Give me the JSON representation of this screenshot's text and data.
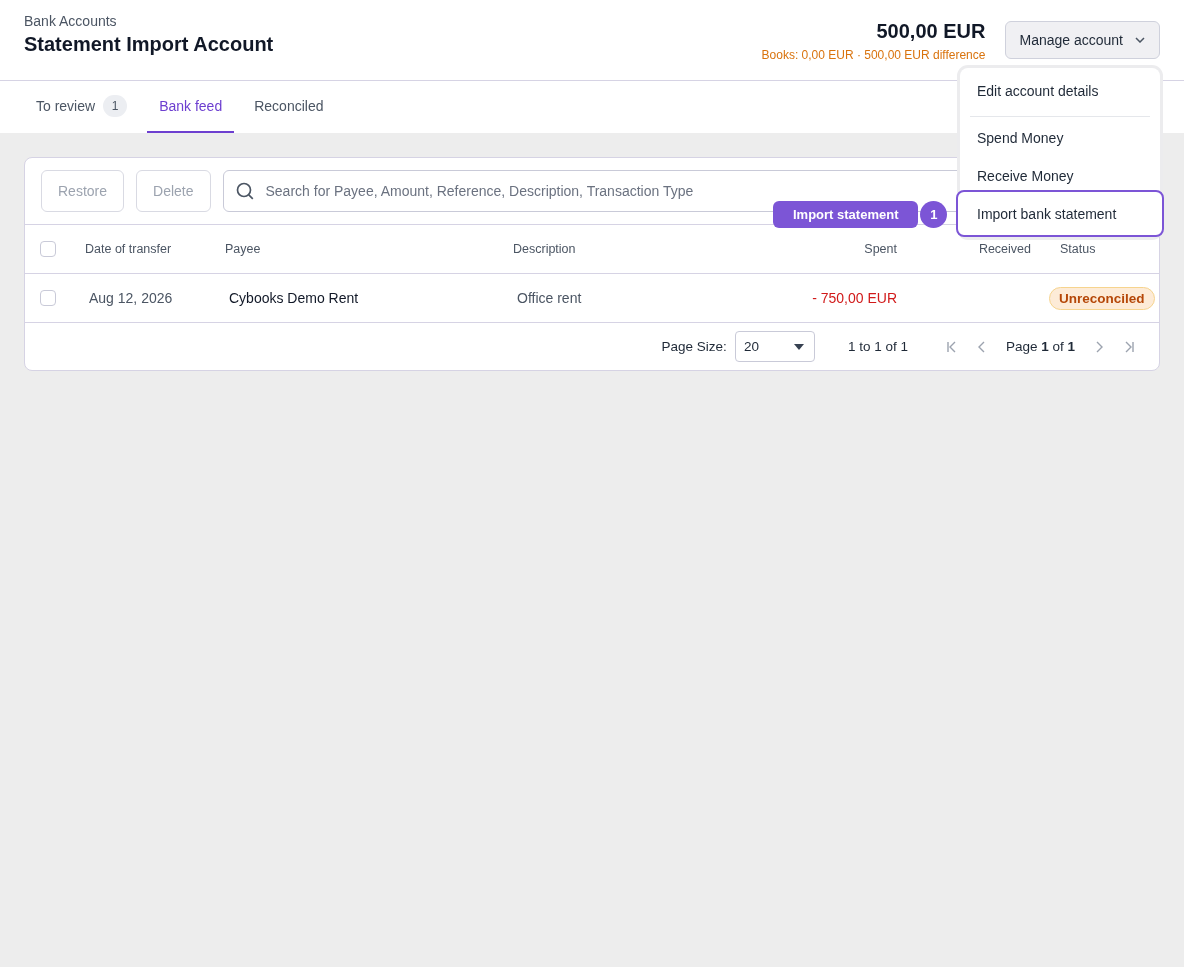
{
  "header": {
    "breadcrumb": "Bank Accounts",
    "title": "Statement Import Account",
    "balance": "500,00 EUR",
    "books_note": "Books: 0,00 EUR · 500,00 EUR difference",
    "manage_button": "Manage account"
  },
  "tabs": [
    {
      "label": "To review",
      "count": "1",
      "selected": false
    },
    {
      "label": "Bank feed",
      "selected": true
    },
    {
      "label": "Reconciled",
      "selected": false
    }
  ],
  "toolbar": {
    "buttons": [
      {
        "label": "Restore",
        "disabled": true
      },
      {
        "label": "Delete",
        "disabled": true
      }
    ],
    "search": {
      "placeholder": "Search for Payee, Amount, Reference, Description, Transaction Type"
    }
  },
  "table": {
    "select_all_checked": false,
    "columns": [
      "Date of transfer",
      "Payee",
      "Description",
      "Spent",
      "Received",
      "Status"
    ],
    "rows": [
      {
        "checked": false,
        "date": "Aug 12, 2026",
        "payee": "Cybooks Demo Rent",
        "description": "Office rent",
        "spent": "- 750,00 EUR",
        "status": "Unreconciled"
      }
    ]
  },
  "pagination": {
    "page_size_label": "Page Size:",
    "page_size": "20",
    "range": "1 to 1 of 1",
    "page": "Page **1** of **1**"
  },
  "menu": {
    "items": [
      {
        "label": "Edit account details",
        "separated": true,
        "highlighted": false
      },
      {
        "label": "Spend Money",
        "separated": false,
        "highlighted": false
      },
      {
        "label": "Receive Money",
        "separated": false,
        "highlighted": false
      },
      {
        "label": "Import bank statement",
        "separated": false,
        "highlighted": true
      }
    ]
  },
  "tour": {
    "tooltip": "Import statement",
    "step": "1"
  }
}
